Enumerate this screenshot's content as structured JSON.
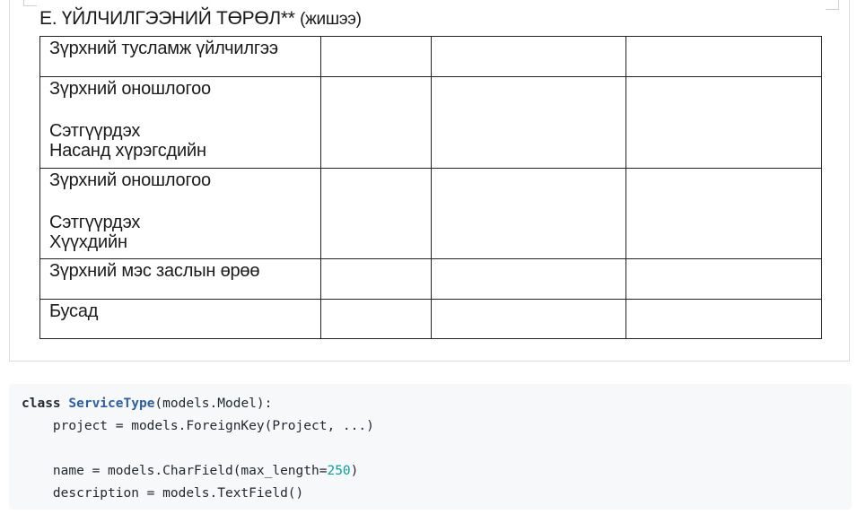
{
  "document": {
    "title": "E. ҮЙЛЧИЛГЭЭНИЙ ТӨРӨЛ**",
    "title_note": "(жишээ)",
    "rows": [
      {
        "lines": [
          "Зүрхний тусламж үйлчилгээ"
        ]
      },
      {
        "lines": [
          "Зүрхний оношлогоо",
          "",
          "Сэтгүүрдэх",
          "Насанд хүрэгсдийн"
        ]
      },
      {
        "lines": [
          "Зүрхний оношлогоо",
          "",
          "Сэтгүүрдэх",
          "Хүүхдийн"
        ]
      },
      {
        "lines": [
          "Зүрхний мэс заслын өрөө"
        ]
      },
      {
        "lines": [
          "Бусад"
        ]
      }
    ]
  },
  "code": {
    "line1": {
      "keyword": "class",
      "class_name": "ServiceType",
      "rest": "(models.Model):"
    },
    "line2": "    project = models.ForeignKey(Project, ...)",
    "line4": {
      "before": "    name = models.CharField(max_length=",
      "number": "250",
      "after": ")"
    },
    "line5": "    description = models.TextField()"
  },
  "colors": {
    "code_background": "#f6f8fa",
    "class_name": "#2f5f9e",
    "number_literal": "#0aa0a0"
  }
}
